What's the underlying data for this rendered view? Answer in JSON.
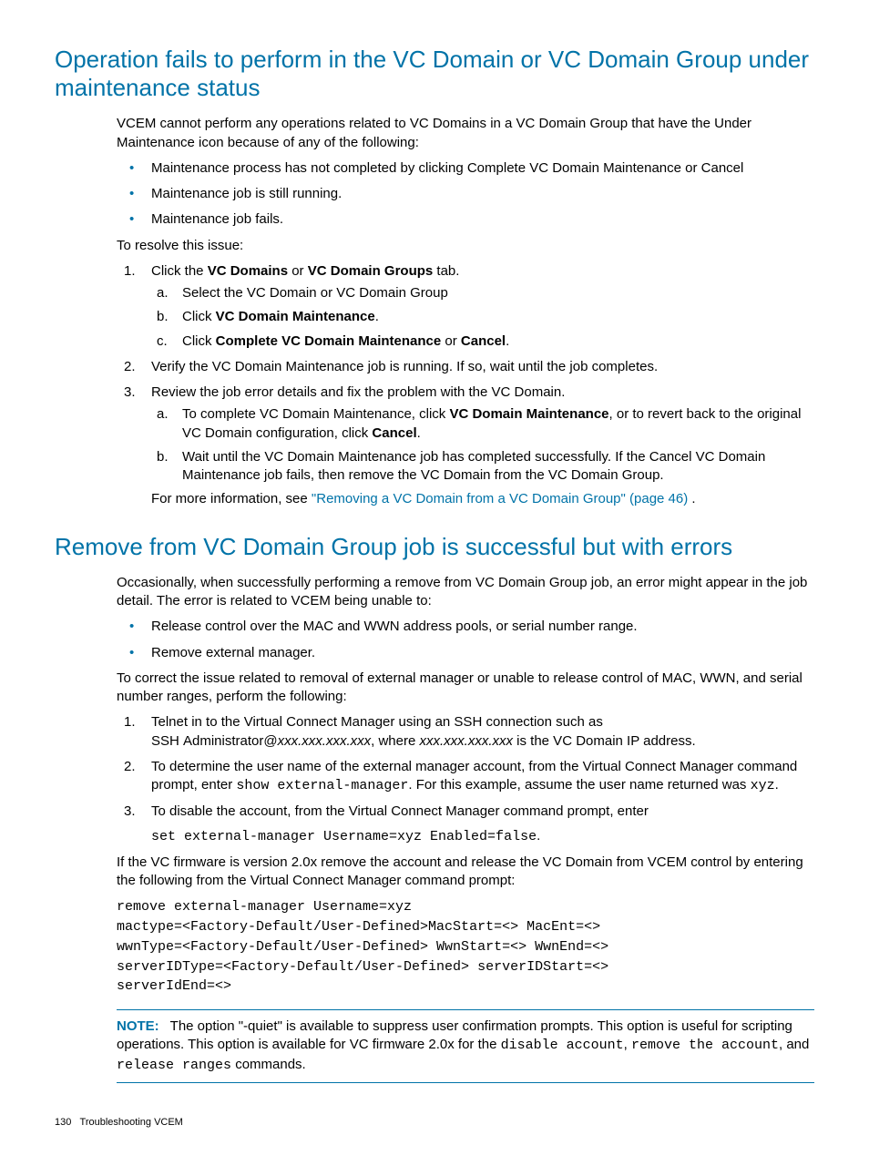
{
  "h1": "Operation fails to perform in the VC Domain or VC Domain Group under maintenance status",
  "p1": "VCEM cannot perform any operations related to VC Domains in a VC Domain Group that have the Under Maintenance icon because of any of the following:",
  "b1": "Maintenance process has not completed by clicking Complete VC Domain Maintenance or Cancel",
  "b2": "Maintenance job is still running.",
  "b3": "Maintenance job fails.",
  "p2": "To resolve this issue:",
  "s1_pre": "Click the ",
  "s1_b1": "VC Domains",
  "s1_mid": " or ",
  "s1_b2": "VC Domain Groups",
  "s1_post": " tab.",
  "s1a": "Select the VC Domain or VC Domain Group",
  "s1b_pre": "Click ",
  "s1b_b": "VC Domain Maintenance",
  "s1b_post": ".",
  "s1c_pre": "Click ",
  "s1c_b1": "Complete VC Domain Maintenance",
  "s1c_mid": " or ",
  "s1c_b2": "Cancel",
  "s1c_post": ".",
  "s2": "Verify the VC Domain Maintenance job is running. If so, wait until the job completes.",
  "s3": "Review the job error details and fix the problem with the VC Domain.",
  "s3a_pre": "To complete VC Domain Maintenance, click ",
  "s3a_b1": "VC Domain Maintenance",
  "s3a_mid": ", or to revert back to the original VC Domain configuration, click ",
  "s3a_b2": "Cancel",
  "s3a_post": ".",
  "s3b": "Wait until the VC Domain Maintenance job has completed successfully. If the Cancel VC Domain Maintenance job fails, then remove the VC Domain from the VC Domain Group.",
  "more_pre": "For more information, see ",
  "more_link": "\"Removing a VC Domain from a VC Domain Group\" (page 46)",
  "more_post": " .",
  "h2": "Remove from VC Domain Group job is successful but with errors",
  "p3": "Occasionally, when successfully performing a remove from VC Domain Group job, an error might appear in the job detail. The error is related to VCEM being unable to:",
  "c1": "Release control over the MAC and WWN address pools, or serial number range.",
  "c2": "Remove external manager.",
  "p4": "To correct the issue related to removal of external manager or unable to release control of MAC, WWN, and serial number ranges, perform the following:",
  "t1_a": "Telnet in to the Virtual Connect Manager using an SSH connection such as SSH Administrator@",
  "t1_i1": "xxx.xxx.xxx.xxx",
  "t1_b": ", where ",
  "t1_i2": "xxx.xxx.xxx.xxx",
  "t1_c": " is the VC Domain IP address.",
  "t2_a": "To determine the user name of the external manager account, from the Virtual Connect Manager command prompt, enter ",
  "t2_code1": "show external-manager",
  "t2_b": ". For this example, assume the user name returned was ",
  "t2_code2": "xyz",
  "t2_c": ".",
  "t3": "To disable the account, from the Virtual Connect Manager command prompt, enter",
  "t3_code": "set external-manager Username=xyz Enabled=false",
  "t3_dot": ".",
  "p5": "If the VC firmware is version 2.0x remove the account and release the VC Domain from VCEM control by entering the following from the Virtual Connect Manager command prompt:",
  "codeblock": "remove external-manager Username=xyz\nmactype=<Factory-Default/User-Defined>MacStart=<> MacEnt=<>\nwwnType=<Factory-Default/User-Defined> WwnStart=<> WwnEnd=<>\nserverIDType=<Factory-Default/User-Defined> serverIDStart=<>\nserverIdEnd=<>",
  "note_label": "NOTE:",
  "note_a": "The option \"-quiet\" is available to suppress user confirmation prompts. This option is useful for scripting operations. This option is available for VC firmware 2.0x for the ",
  "note_c1": "disable account",
  "note_b": ", ",
  "note_c2": "remove the account",
  "note_c": ", and ",
  "note_c3": "release ranges",
  "note_d": " commands.",
  "footer_page": "130",
  "footer_title": "Troubleshooting VCEM"
}
